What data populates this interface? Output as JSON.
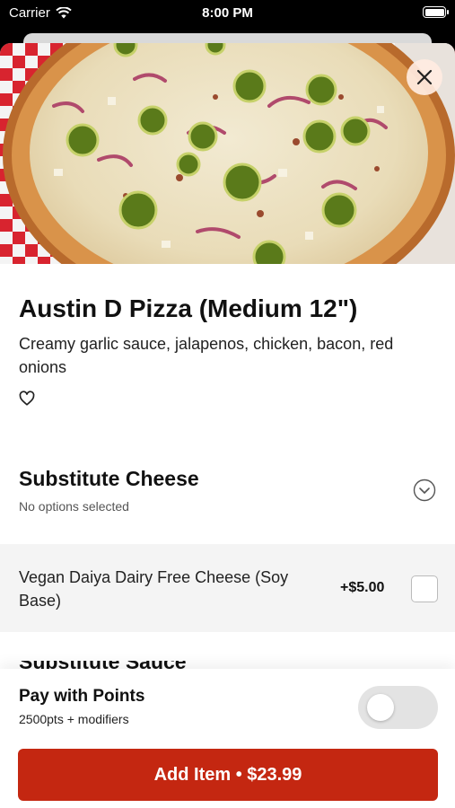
{
  "status_bar": {
    "carrier": "Carrier",
    "time": "8:00 PM",
    "icons": [
      "wifi-icon",
      "battery-icon"
    ]
  },
  "close_icon": "close-icon",
  "item": {
    "title": "Austin D Pizza (Medium 12\")",
    "description": "Creamy garlic sauce, jalapenos, chicken, bacon, red onions",
    "favorite_icon": "heart-outline-icon"
  },
  "modifier_group": {
    "title": "Substitute Cheese",
    "subtitle": "No options selected",
    "expand_icon": "chevron-down-circle-icon",
    "options": [
      {
        "label": "Vegan Daiya Dairy Free Cheese (Soy Base)",
        "price": "+$5.00",
        "selected": false
      }
    ]
  },
  "next_group_peek": "Substitute Sauce",
  "pay_with_points": {
    "title": "Pay with Points",
    "subtitle": "2500pts + modifiers",
    "enabled": false
  },
  "add_button": {
    "label": "Add Item • $23.99"
  },
  "colors": {
    "accent": "#c42711",
    "toggle_off": "#e3e3e3",
    "option_bg": "#f4f4f4"
  }
}
